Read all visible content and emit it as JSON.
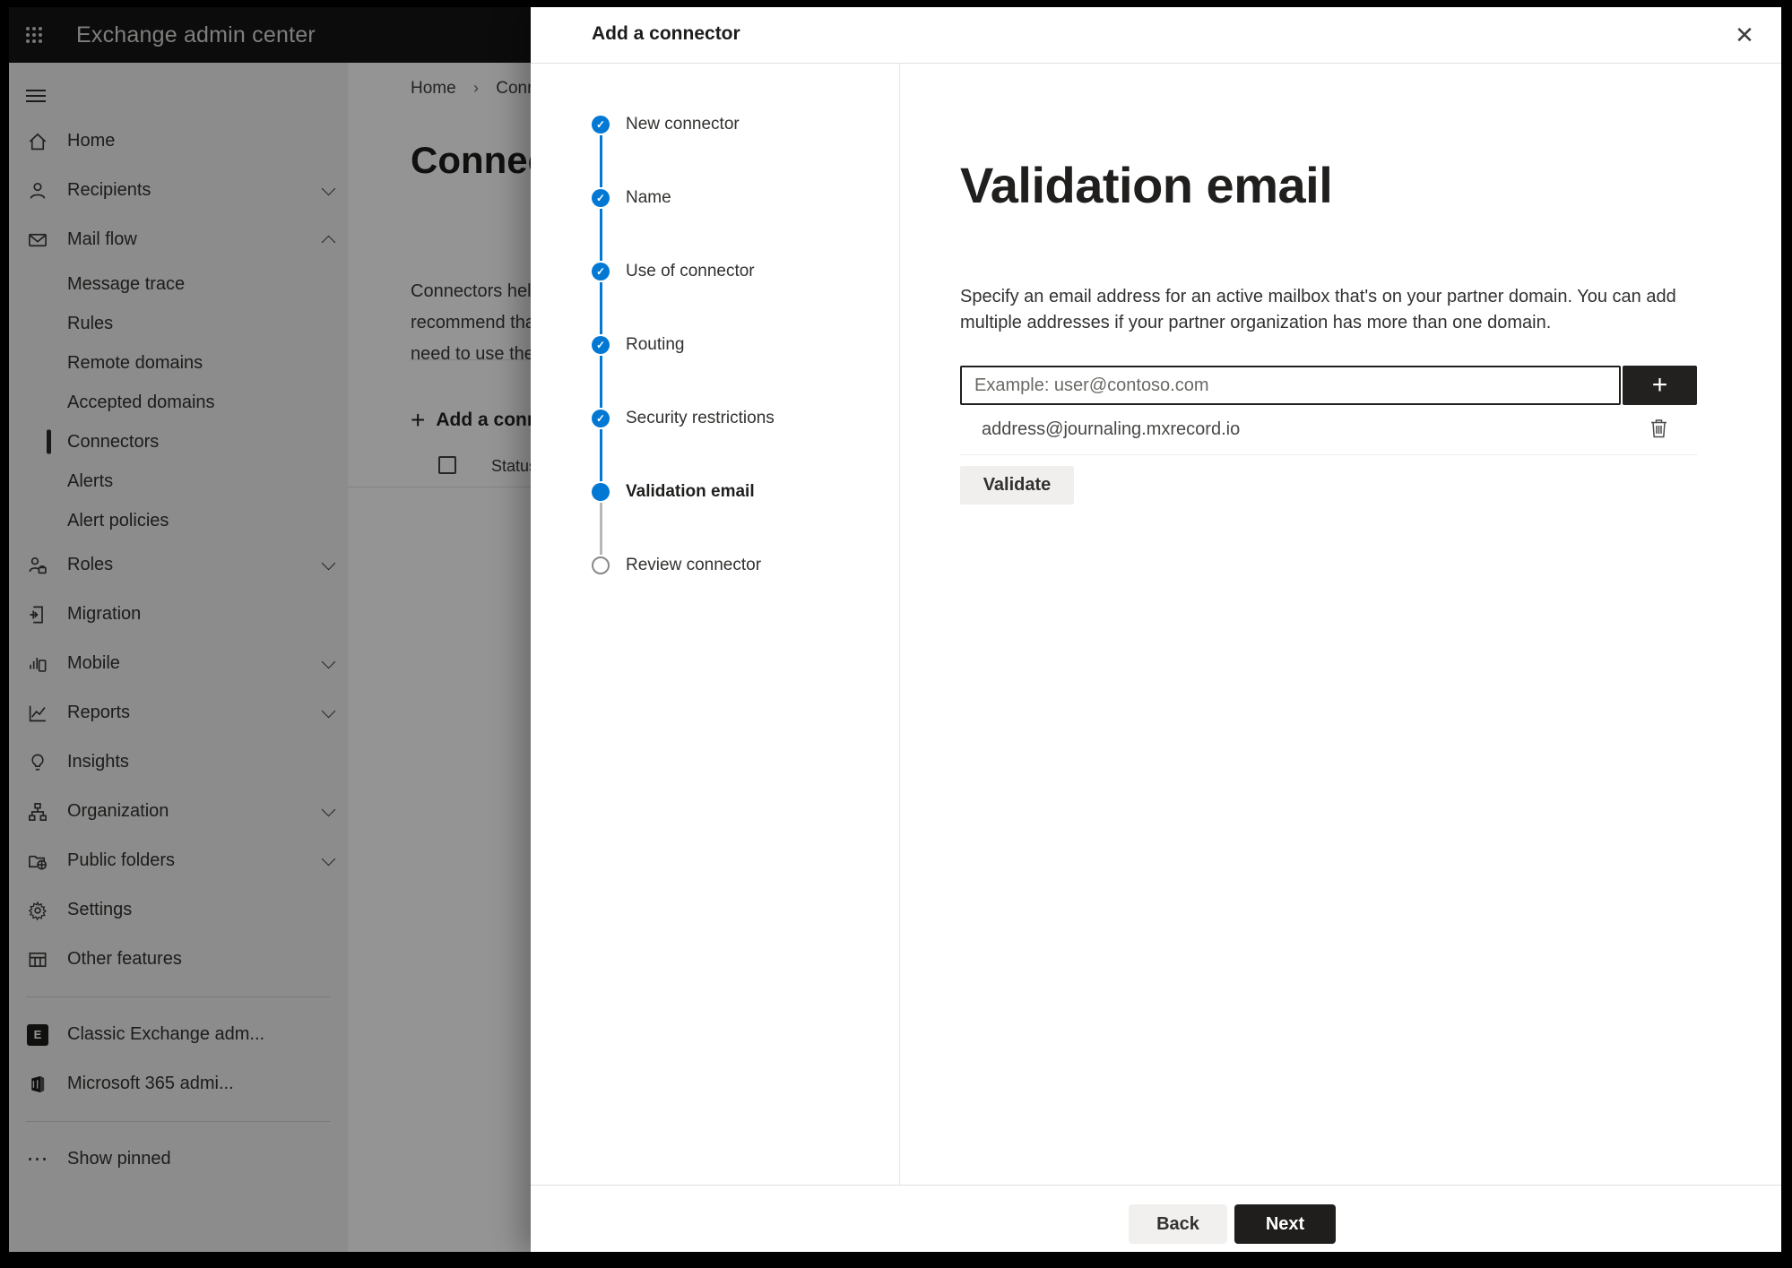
{
  "topbar": {
    "title": "Exchange admin center"
  },
  "sidebar": {
    "items": [
      {
        "id": "home",
        "label": "Home",
        "icon": "home"
      },
      {
        "id": "recipients",
        "label": "Recipients",
        "icon": "person",
        "chevron": "down"
      },
      {
        "id": "mail-flow",
        "label": "Mail flow",
        "icon": "mail",
        "chevron": "up"
      },
      {
        "id": "message-trace",
        "label": "Message trace",
        "sub": true
      },
      {
        "id": "rules",
        "label": "Rules",
        "sub": true
      },
      {
        "id": "remote-domains",
        "label": "Remote domains",
        "sub": true
      },
      {
        "id": "accepted-domains",
        "label": "Accepted domains",
        "sub": true
      },
      {
        "id": "connectors",
        "label": "Connectors",
        "sub": true,
        "selected": true
      },
      {
        "id": "alerts",
        "label": "Alerts",
        "sub": true
      },
      {
        "id": "alert-policies",
        "label": "Alert policies",
        "sub": true
      },
      {
        "id": "roles",
        "label": "Roles",
        "icon": "roles",
        "chevron": "down"
      },
      {
        "id": "migration",
        "label": "Migration",
        "icon": "migration"
      },
      {
        "id": "mobile",
        "label": "Mobile",
        "icon": "mobile",
        "chevron": "down"
      },
      {
        "id": "reports",
        "label": "Reports",
        "icon": "reports",
        "chevron": "down"
      },
      {
        "id": "insights",
        "label": "Insights",
        "icon": "insights"
      },
      {
        "id": "organization",
        "label": "Organization",
        "icon": "organization",
        "chevron": "down"
      },
      {
        "id": "public-folders",
        "label": "Public folders",
        "icon": "folders",
        "chevron": "down"
      },
      {
        "id": "settings",
        "label": "Settings",
        "icon": "settings"
      },
      {
        "id": "other-features",
        "label": "Other features",
        "icon": "grid"
      },
      {
        "divider": true
      },
      {
        "id": "classic-exchange-admin",
        "label": "Classic Exchange adm...",
        "icon": "exchange"
      },
      {
        "id": "microsoft-365-admin",
        "label": "Microsoft 365 admi...",
        "icon": "office"
      },
      {
        "divider": true
      },
      {
        "id": "show-pinned",
        "label": "Show pinned",
        "icon": "dots"
      }
    ]
  },
  "background": {
    "breadcrumb": {
      "home": "Home",
      "separator": "›",
      "current": "Conne"
    },
    "page_title": "Connec",
    "description_lines": [
      "Connectors help",
      "recommend that",
      "need to use ther"
    ],
    "add_button_label": "Add a conn",
    "add_button_plus": "+",
    "status_header": "Status"
  },
  "dialog": {
    "title": "Add a connector",
    "close_glyph": "✕",
    "steps": [
      {
        "label": "New connector",
        "state": "done"
      },
      {
        "label": "Name",
        "state": "done"
      },
      {
        "label": "Use of connector",
        "state": "done"
      },
      {
        "label": "Routing",
        "state": "done"
      },
      {
        "label": "Security restrictions",
        "state": "done"
      },
      {
        "label": "Validation email",
        "state": "active"
      },
      {
        "label": "Review connector",
        "state": "upcoming"
      }
    ],
    "content": {
      "heading": "Validation email",
      "instructions": "Specify an email address for an active mailbox that's on your partner domain. You can add multiple addresses if your partner organization has more than one domain.",
      "email_input": {
        "value": "",
        "placeholder": "Example: user@contoso.com"
      },
      "add_email_button": "+",
      "added_emails": [
        {
          "address": "address@journaling.mxrecord.io"
        }
      ],
      "validate_button": "Validate"
    },
    "footer": {
      "back_button": "Back",
      "next_button": "Next"
    }
  },
  "colors": {
    "accent": "#0078d4",
    "dark_button": "#1f1e1d",
    "scrim": "rgba(0,0,0,0.42)"
  }
}
